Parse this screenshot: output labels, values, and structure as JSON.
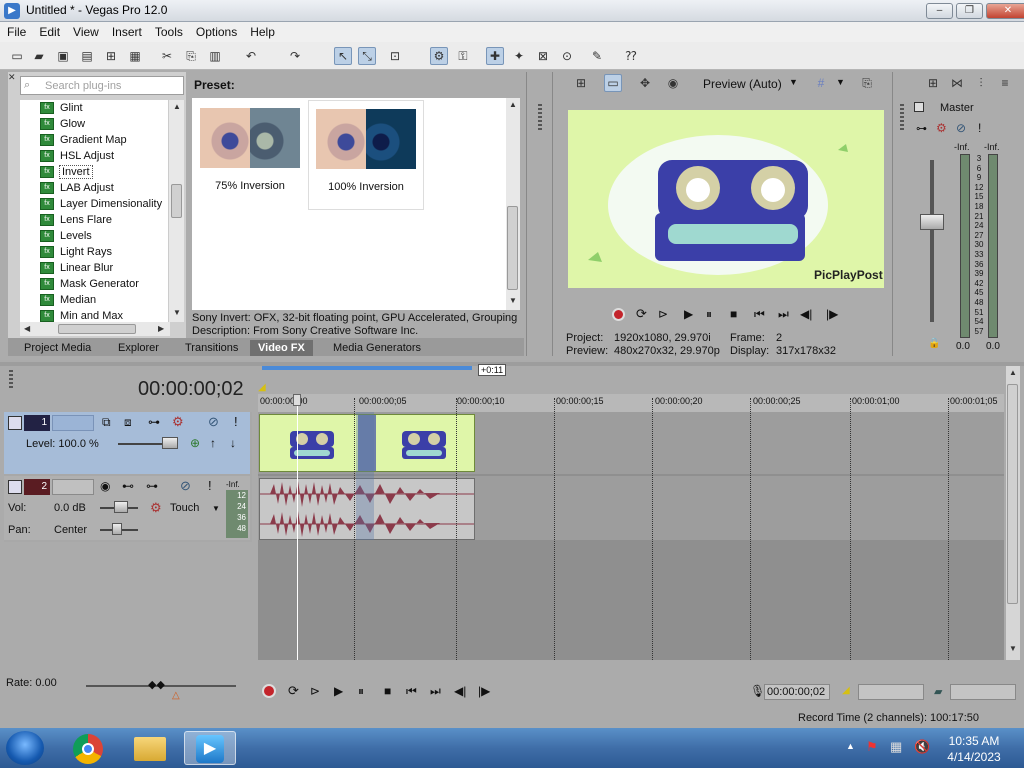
{
  "window": {
    "title": "Untitled * - Vegas Pro 12.0",
    "icon": "vegas-app-icon"
  },
  "window_controls": {
    "minimize": "–",
    "maximize": "❐",
    "close": "✕"
  },
  "menu": [
    "File",
    "Edit",
    "View",
    "Insert",
    "Tools",
    "Options",
    "Help"
  ],
  "plugin_chooser": {
    "search_placeholder": "Search plug-ins",
    "items": [
      "Glint",
      "Glow",
      "Gradient Map",
      "HSL Adjust",
      "Invert",
      "LAB Adjust",
      "Layer Dimensionality",
      "Lens Flare",
      "Levels",
      "Light Rays",
      "Linear Blur",
      "Mask Generator",
      "Median",
      "Min and Max"
    ],
    "selected": "Invert"
  },
  "preset": {
    "label": "Preset:",
    "items": [
      {
        "name": "75% Inversion"
      },
      {
        "name": "100% Inversion",
        "selected": true
      }
    ]
  },
  "fx_description": {
    "line1": "Sony Invert: OFX, 32-bit floating point, GPU Accelerated, Grouping :",
    "line2": "Description: From Sony Creative Software Inc."
  },
  "tabs": [
    "Project Media",
    "Explorer",
    "Transitions",
    "Video FX",
    "Media Generators"
  ],
  "active_tab": "Video FX",
  "preview": {
    "mode": "Preview (Auto)",
    "watermark": "PicPlayPost",
    "project_label": "Project:",
    "project_value": "1920x1080, 29.970i",
    "preview_label": "Preview:",
    "preview_value": "480x270x32, 29.970p",
    "frame_label": "Frame:",
    "frame_value": "2",
    "display_label": "Display:",
    "display_value": "317x178x32"
  },
  "master": {
    "title": "Master",
    "inf_left": "-Inf.",
    "inf_right": "-Inf.",
    "scale": [
      "3",
      "6",
      "9",
      "12",
      "15",
      "18",
      "21",
      "24",
      "27",
      "30",
      "33",
      "36",
      "39",
      "42",
      "45",
      "48",
      "51",
      "54",
      "57"
    ],
    "value_left": "0.0",
    "value_right": "0.0"
  },
  "timeline": {
    "timecode": "00:00:00;02",
    "loop_marker": "+0:11",
    "ruler": [
      "00:00:00;00",
      "00:00:00;05",
      "00:00:00;10",
      "00:00:00;15",
      "00:00:00;20",
      "00:00:00;25",
      "00:00:01;00",
      "00:00:01;05"
    ],
    "video_track": {
      "number": "1",
      "level_label": "Level: 100.0 %"
    },
    "audio_track": {
      "number": "2",
      "vol_label": "Vol:",
      "vol_value": "0.0 dB",
      "pan_label": "Pan:",
      "pan_value": "Center",
      "automation": "Touch",
      "meter_inf": "-Inf.",
      "meter_scale": [
        "12",
        "24",
        "36",
        "48"
      ]
    }
  },
  "transport": {
    "rate": "Rate: 0.00",
    "cursor_time": "00:00:00;02"
  },
  "status": {
    "record_time": "Record Time (2 channels): 100:17:50"
  },
  "taskbar": {
    "time": "10:35 AM",
    "date": "4/14/2023"
  },
  "colors": {
    "accent": "#3399ff",
    "video_clip": "#d5f0a0",
    "audio_wave": "#8b3a4a",
    "video_track_header": "#a6bcd8"
  }
}
